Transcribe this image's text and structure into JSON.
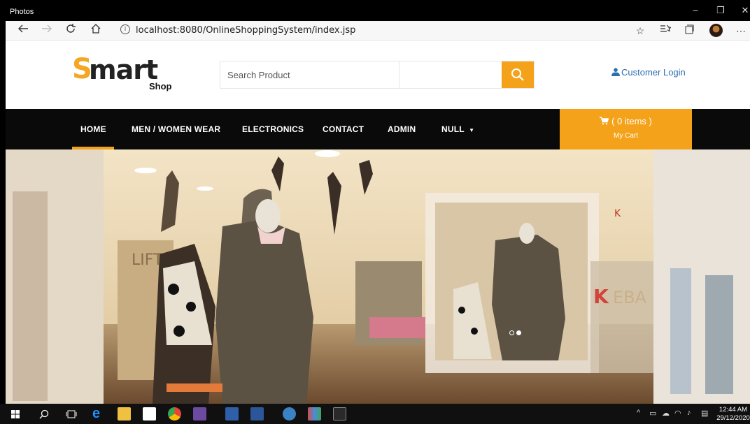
{
  "window": {
    "app_title": "Photos",
    "minimize": "–",
    "restore": "❐",
    "close": "✕"
  },
  "browser": {
    "url": "localhost:8080/OnlineShoppingSystem/index.jsp",
    "info_glyph": "i",
    "icons": [
      "back-icon",
      "forward-icon",
      "refresh-icon",
      "home-icon",
      "favorite-icon",
      "favorites-list-icon",
      "collections-icon",
      "profile-icon",
      "more-icon"
    ]
  },
  "site": {
    "logo_s": "S",
    "logo_text": "mart",
    "logo_sub": "Shop",
    "search": {
      "placeholder": "Search Product",
      "value": ""
    },
    "login_label": "Customer Login",
    "nav": [
      "HOME",
      "MEN / WOMEN WEAR",
      "ELECTRONICS",
      "CONTACT",
      "ADMIN",
      "NULL"
    ],
    "active_nav": "HOME",
    "cart": {
      "count_label": "( 0 items )",
      "label": "My Cart"
    },
    "carousel": {
      "slide_count": 2,
      "active_slide": 2
    }
  },
  "taskbar": {
    "clock_time": "12:44 AM",
    "clock_date": "29/12/2020",
    "tray_chevron": "^"
  },
  "colors": {
    "accent": "#f5a21b",
    "nav_bg": "#0a0a0a",
    "link": "#2a6fb2"
  }
}
